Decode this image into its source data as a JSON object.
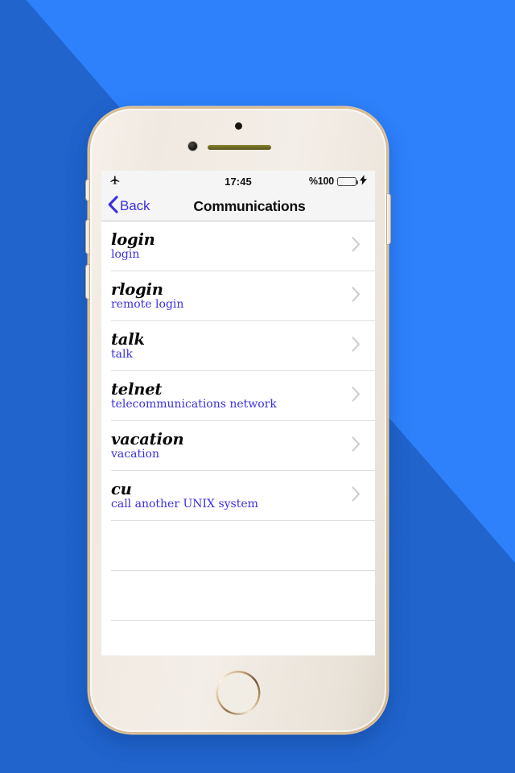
{
  "theme": {
    "background_blue": "#2e80fb",
    "shadow_blue": "#2166cc",
    "accent_blue": "#3b2fe0",
    "subtitle_blue": "#3b30de",
    "battery_green": "#4cd964",
    "separator_gray": "#dedede",
    "nav_bar_gray": "#f5f5f5"
  },
  "device": {
    "name": "iphone-gold",
    "hardware": {
      "earpiece": "earpiece-speaker",
      "front_camera": "front-camera",
      "sensor": "proximity-sensor",
      "home_button": "home-button",
      "buttons": [
        "mute-switch",
        "volume-up-button",
        "volume-down-button",
        "power-button"
      ]
    }
  },
  "status_bar": {
    "airplane_icon": "airplane-mode-icon",
    "time": "17:45",
    "battery_percent": "%100",
    "battery_level": 100,
    "battery_icon": "battery-full-icon",
    "charging_icon": "lightning-bolt-icon"
  },
  "nav_bar": {
    "back_icon": "chevron-left-icon",
    "back_label": "Back",
    "title": "Communications"
  },
  "list": {
    "disclosure_icon": "chevron-right-icon",
    "items": [
      {
        "title": "login",
        "subtitle": "login"
      },
      {
        "title": "rlogin",
        "subtitle": "remote login"
      },
      {
        "title": "talk",
        "subtitle": "talk"
      },
      {
        "title": "telnet",
        "subtitle": "telecommunications network"
      },
      {
        "title": "vacation",
        "subtitle": "vacation"
      },
      {
        "title": "cu",
        "subtitle": "call another UNIX system"
      }
    ],
    "empty_rows": 2
  }
}
